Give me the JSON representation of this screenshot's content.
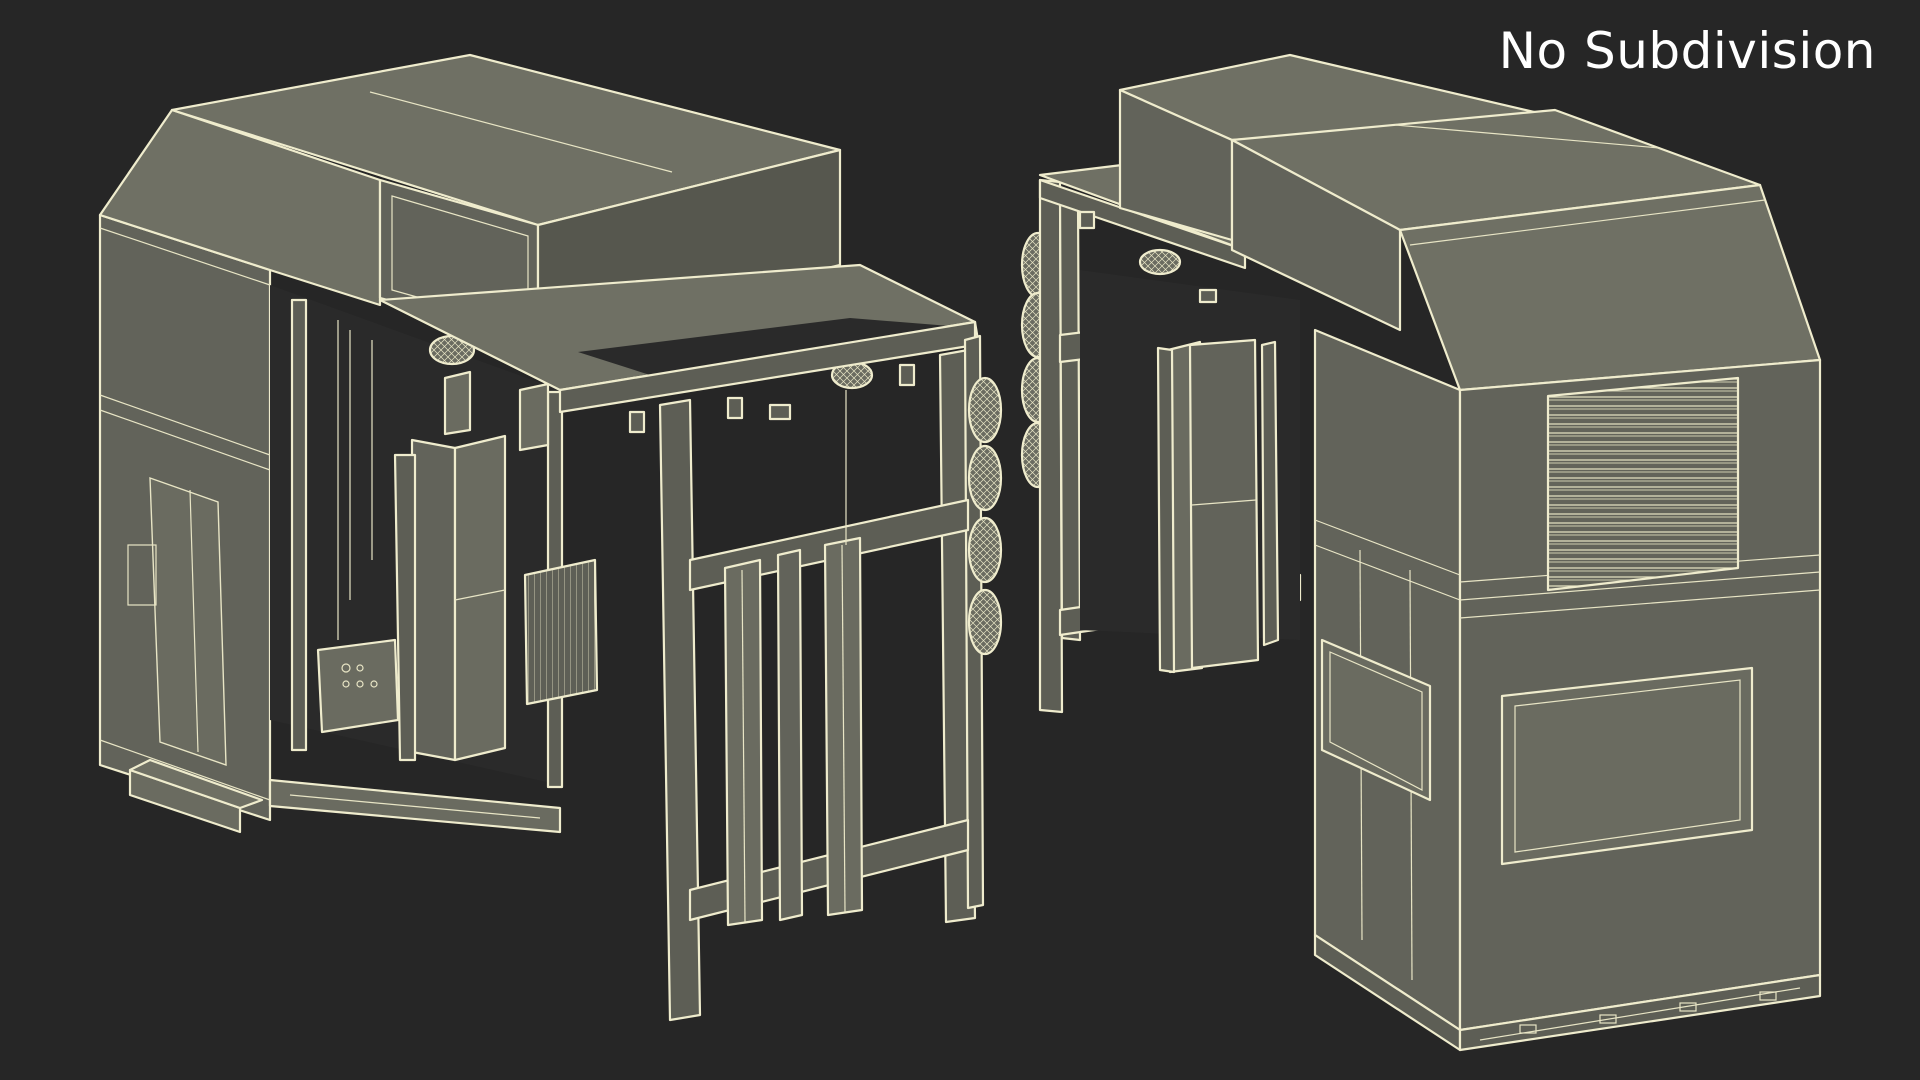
{
  "viewport": {
    "overlay_label": "No Subdivision",
    "background_color": "#262626",
    "model_fill_color": "#66675d",
    "wire_color": "#efeccd"
  }
}
